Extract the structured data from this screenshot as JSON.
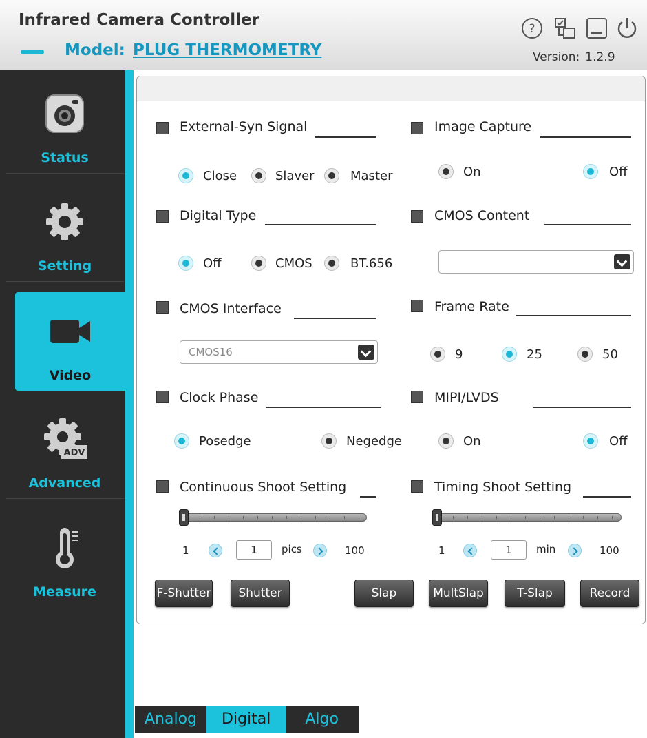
{
  "header": {
    "title": "Infrared Camera Controller",
    "model_label": "Model:",
    "model_value": "PLUG THERMOMETRY",
    "version_label": "Version:",
    "version_value": "1.2.9",
    "icons": [
      "help-icon",
      "settings-switch-icon",
      "minimize-icon",
      "power-icon"
    ]
  },
  "sidebar": {
    "accent_color": "#1cc1dc",
    "items": [
      {
        "label": "Status",
        "icon": "camera-icon"
      },
      {
        "label": "Setting",
        "icon": "gear-icon"
      },
      {
        "label": "Video",
        "icon": "video-camera-icon"
      },
      {
        "label": "Advanced",
        "icon": "advanced-gear-icon"
      },
      {
        "label": "Measure",
        "icon": "thermometer-icon"
      }
    ],
    "active": "Video"
  },
  "panel": {
    "external_syn": {
      "label": "External-Syn Signal",
      "options": [
        "Close",
        "Slaver",
        "Master"
      ],
      "selected": "Close"
    },
    "image_capture": {
      "label": "Image Capture",
      "options": [
        "On",
        "Off"
      ],
      "selected": "Off"
    },
    "digital_type": {
      "label": "Digital Type",
      "options": [
        "Off",
        "CMOS",
        "BT.656"
      ],
      "selected": "Off"
    },
    "cmos_content": {
      "label": "CMOS Content",
      "value": ""
    },
    "cmos_interface": {
      "label": "CMOS Interface",
      "value": "CMOS16"
    },
    "frame_rate": {
      "label": "Frame Rate",
      "options": [
        "9",
        "25",
        "50"
      ],
      "selected": "25"
    },
    "clock_phase": {
      "label": "Clock Phase",
      "options": [
        "Posedge",
        "Negedge"
      ],
      "selected": "Posedge"
    },
    "mipi_lvds": {
      "label": "MIPI/LVDS",
      "options": [
        "On",
        "Off"
      ],
      "selected": "Off"
    },
    "continuous_shoot": {
      "label": "Continuous Shoot Setting",
      "min": "1",
      "max": "100",
      "value": "1",
      "unit": "pics"
    },
    "timing_shoot": {
      "label": "Timing Shoot Setting",
      "min": "1",
      "max": "100",
      "value": "1",
      "unit": "min"
    },
    "buttons": [
      "F-Shutter",
      "Shutter",
      "Slap",
      "MultSlap",
      "T-Slap",
      "Record"
    ]
  },
  "tabs": {
    "items": [
      "Analog",
      "Digital",
      "Algo"
    ],
    "active": "Digital"
  }
}
